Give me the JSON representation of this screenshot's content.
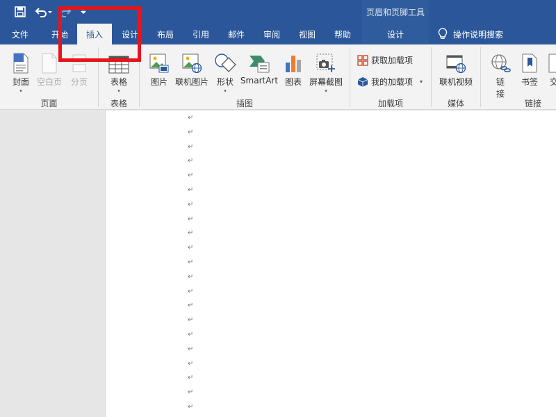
{
  "titlebar": {
    "context_title": "页眉和页脚工具",
    "bg_color": "#2b579a",
    "qat": [
      "save-icon",
      "undo-icon",
      "redo-icon",
      "customize-qat-icon"
    ]
  },
  "tabs": {
    "items": [
      {
        "label": "文件"
      },
      {
        "label": "开始"
      },
      {
        "label": "插入"
      },
      {
        "label": "设计"
      },
      {
        "label": "布局"
      },
      {
        "label": "引用"
      },
      {
        "label": "邮件"
      },
      {
        "label": "审阅"
      },
      {
        "label": "视图"
      },
      {
        "label": "帮助"
      },
      {
        "label": "设计"
      }
    ],
    "active": "插入",
    "tell_me": "操作说明搜索"
  },
  "ribbon": {
    "pages": {
      "cover": "封面",
      "blank": "空白页",
      "break": "分页",
      "label": "页面"
    },
    "tables": {
      "table": "表格",
      "label": "表格"
    },
    "illustrations": {
      "pictures": "图片",
      "online_pictures": "联机图片",
      "shapes": "形状",
      "smartart": "SmartArt",
      "chart": "图表",
      "screenshot": "屏幕截图",
      "label": "插图"
    },
    "addins": {
      "get": "获取加载项",
      "my": "我的加载项",
      "label": "加载项"
    },
    "media": {
      "online_video": "联机视频",
      "label": "媒体"
    },
    "links": {
      "link_line1": "链",
      "link_line2": "接",
      "bookmark": "书签",
      "crossref": "交",
      "label": "链接"
    }
  },
  "document": {
    "paragraph_mark": "↵"
  },
  "highlight_color": "#e8141b"
}
